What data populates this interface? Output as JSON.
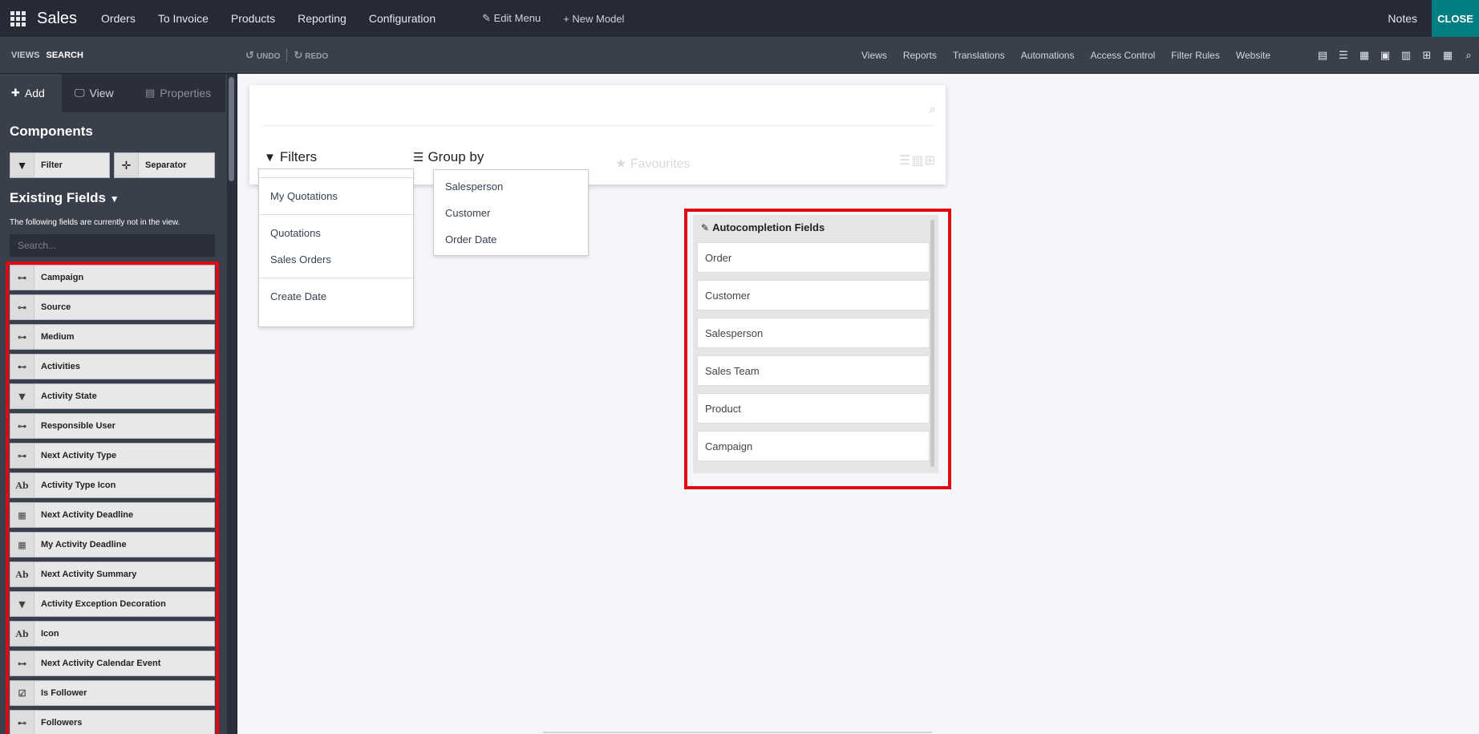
{
  "navbar": {
    "brand": "Sales",
    "menu": [
      "Orders",
      "To Invoice",
      "Products",
      "Reporting",
      "Configuration"
    ],
    "edit_menu": "Edit Menu",
    "new_model": "New Model",
    "notes": "Notes",
    "close": "CLOSE"
  },
  "subbar": {
    "crumb_views": "VIEWS",
    "crumb_search": "SEARCH",
    "undo": "UNDO",
    "redo": "REDO",
    "links": [
      "Views",
      "Reports",
      "Translations",
      "Automations",
      "Access Control",
      "Filter Rules",
      "Website"
    ],
    "view_icons": [
      "form-view-icon",
      "list-view-icon",
      "kanban-view-icon",
      "calendar-view-icon",
      "graph-view-icon",
      "pivot-view-icon",
      "grid-view-icon",
      "search-view-icon"
    ]
  },
  "sidebar": {
    "tabs": [
      "Add",
      "View",
      "Properties"
    ],
    "components_title": "Components",
    "components": [
      "Filter",
      "Separator"
    ],
    "existing_title": "Existing Fields",
    "existing_desc": "The following fields are currently not in the view.",
    "search_placeholder": "Search...",
    "fields": [
      {
        "label": "Campaign",
        "icon": "many2one-icon"
      },
      {
        "label": "Source",
        "icon": "many2one-icon"
      },
      {
        "label": "Medium",
        "icon": "many2one-icon"
      },
      {
        "label": "Activities",
        "icon": "one2many-icon"
      },
      {
        "label": "Activity State",
        "icon": "selection-icon"
      },
      {
        "label": "Responsible User",
        "icon": "many2one-icon"
      },
      {
        "label": "Next Activity Type",
        "icon": "many2one-icon"
      },
      {
        "label": "Activity Type Icon",
        "icon": "char-icon"
      },
      {
        "label": "Next Activity Deadline",
        "icon": "date-icon"
      },
      {
        "label": "My Activity Deadline",
        "icon": "date-icon"
      },
      {
        "label": "Next Activity Summary",
        "icon": "char-icon"
      },
      {
        "label": "Activity Exception Decoration",
        "icon": "selection-icon"
      },
      {
        "label": "Icon",
        "icon": "char-icon"
      },
      {
        "label": "Next Activity Calendar Event",
        "icon": "many2one-icon"
      },
      {
        "label": "Is Follower",
        "icon": "boolean-icon"
      },
      {
        "label": "Followers",
        "icon": "one2many-icon"
      }
    ]
  },
  "main": {
    "filters_title": "Filters",
    "groupby_title": "Group by",
    "favourites_title": "Favourites",
    "filters": [
      "My Quotations",
      "Quotations",
      "Sales Orders",
      "Create Date"
    ],
    "groupby": [
      "Salesperson",
      "Customer",
      "Order Date"
    ],
    "autocompletion_title": "Autocompletion Fields",
    "autocompletion": [
      "Order",
      "Customer",
      "Salesperson",
      "Sales Team",
      "Product",
      "Campaign"
    ]
  }
}
